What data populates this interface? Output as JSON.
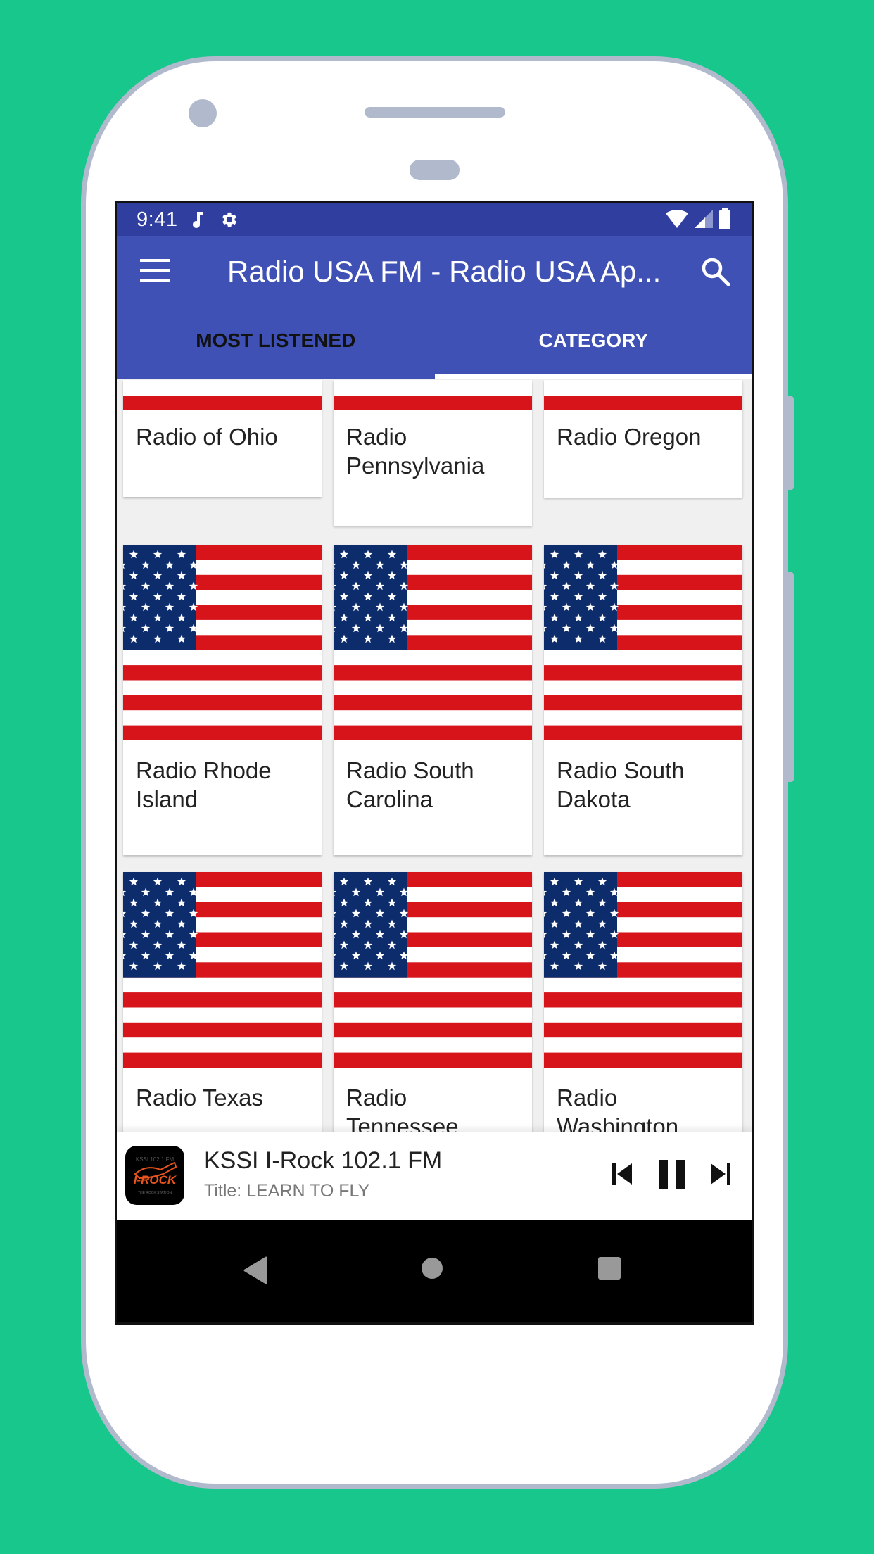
{
  "status_bar": {
    "time": "9:41",
    "left_icons": [
      "music-note-icon",
      "gear-icon"
    ],
    "right_icons": [
      "wifi-icon",
      "cell-signal-icon",
      "battery-icon"
    ]
  },
  "app_bar": {
    "title": "Radio USA FM - Radio USA Ap...",
    "menu_icon": "hamburger-menu-icon",
    "search_icon": "search-icon",
    "color": "#3f51b5",
    "status_color": "#303f9f"
  },
  "tabs": [
    {
      "label": "MOST LISTENED",
      "active": false
    },
    {
      "label": "CATEGORY",
      "active": true
    }
  ],
  "categories": [
    {
      "label": "Radio of Ohio"
    },
    {
      "label": "Radio Pennsylvania"
    },
    {
      "label": "Radio Oregon"
    },
    {
      "label": "Radio Rhode Island"
    },
    {
      "label": "Radio South Carolina"
    },
    {
      "label": "Radio South Dakota"
    },
    {
      "label": "Radio Texas"
    },
    {
      "label": "Radio Tennessee"
    },
    {
      "label": "Radio Washington"
    }
  ],
  "flag_colors": {
    "red": "#d7141a",
    "blue": "#0d2c6b",
    "white": "#ffffff"
  },
  "player": {
    "station": "KSSI I-Rock 102.1 FM",
    "track": "Title: LEARN TO FLY",
    "logo_text": "I-ROCK",
    "controls": [
      "skip-previous-icon",
      "pause-icon",
      "skip-next-icon"
    ]
  },
  "nav_bar": [
    "back-icon",
    "home-icon",
    "recents-icon"
  ],
  "background_color": "#17c78c"
}
